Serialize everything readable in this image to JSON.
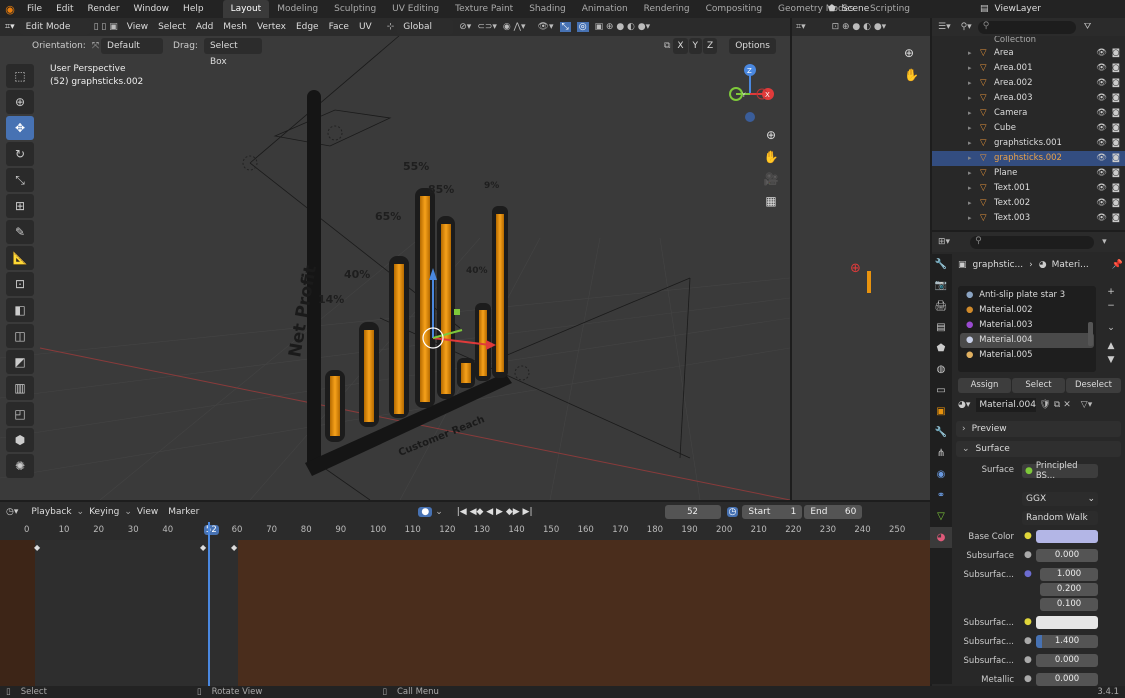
{
  "topbar": {
    "menus": [
      "File",
      "Edit",
      "Render",
      "Window",
      "Help"
    ],
    "workspaces": [
      "Layout",
      "Modeling",
      "Sculpting",
      "UV Editing",
      "Texture Paint",
      "Shading",
      "Animation",
      "Rendering",
      "Compositing",
      "Geometry Nodes",
      "Scripting"
    ],
    "scene": "Scene",
    "view_layer": "ViewLayer"
  },
  "viewport_header": {
    "mode": "Edit Mode",
    "menus": [
      "View",
      "Select",
      "Add",
      "Mesh",
      "Vertex",
      "Edge",
      "Face",
      "UV"
    ],
    "transform": "Global",
    "orientation_label": "Orientation:",
    "orientation_value": "Default",
    "drag_label": "Drag:",
    "drag_value": "Select Box",
    "axes": [
      "X",
      "Y",
      "Z"
    ],
    "options": "Options"
  },
  "viewport_info": {
    "perspective": "User Perspective",
    "object": "(52) graphsticks.002"
  },
  "chart3d_labels": {
    "ylabel": "Net Profit",
    "xlabel": "Customer Reach",
    "pcts": [
      "55%",
      "65%",
      "40%",
      "85%",
      "9%",
      "40%",
      "14%"
    ]
  },
  "gizmo": {
    "z": "Z",
    "y": "Y",
    "x": "X"
  },
  "outliner": {
    "collection": "Collection",
    "items": [
      {
        "name": "Area",
        "selected": false
      },
      {
        "name": "Area.001",
        "selected": false
      },
      {
        "name": "Area.002",
        "selected": false
      },
      {
        "name": "Area.003",
        "selected": false
      },
      {
        "name": "Camera",
        "selected": false
      },
      {
        "name": "Cube",
        "selected": false
      },
      {
        "name": "graphsticks.001",
        "selected": false
      },
      {
        "name": "graphsticks.002",
        "selected": true
      },
      {
        "name": "Plane",
        "selected": false
      },
      {
        "name": "Text.001",
        "selected": false
      },
      {
        "name": "Text.002",
        "selected": false
      },
      {
        "name": "Text.003",
        "selected": false
      }
    ]
  },
  "properties": {
    "breadcrumb_obj": "graphstic...",
    "breadcrumb_mat": "Materi...",
    "materials": [
      "Anti-slip plate star 3",
      "Material.002",
      "Material.003",
      "Material.004",
      "Material.005"
    ],
    "selected_material": "Material.004",
    "assign": "Assign",
    "select": "Select",
    "deselect": "Deselect",
    "material_name": "Material.004",
    "preview": "Preview",
    "surface_section": "Surface",
    "surface_label": "Surface",
    "surface_value": "Principled BS...",
    "distribution": "GGX",
    "sss_method": "Random Walk",
    "base_color_label": "Base Color",
    "base_color": "#b3b6e6",
    "subsurface_label": "Subsurface",
    "subsurface_value": "0.000",
    "subsurface_radius_label": "Subsurfac...",
    "radius": [
      "1.000",
      "0.200",
      "0.100"
    ],
    "subsurface_color_label": "Subsurfac...",
    "subsurface_ior_label": "Subsurfac...",
    "subsurface_ior": "1.400",
    "subsurface_aniso_label": "Subsurfac...",
    "subsurface_aniso": "0.000",
    "metallic_label": "Metallic",
    "metallic": "0.000"
  },
  "timeline": {
    "menus": [
      "Playback",
      "Keying",
      "View",
      "Marker"
    ],
    "current_frame": "52",
    "start_label": "Start",
    "start": "1",
    "end_label": "End",
    "end": "60",
    "ruler": [
      "0",
      "10",
      "20",
      "30",
      "40",
      "52",
      "60",
      "70",
      "80",
      "90",
      "100",
      "110",
      "120",
      "130",
      "140",
      "150",
      "160",
      "170",
      "180",
      "190",
      "200",
      "210",
      "220",
      "230",
      "240",
      "250"
    ]
  },
  "status": {
    "select": "Select",
    "rotate": "Rotate View",
    "call_menu": "Call Menu",
    "version": "3.4.1"
  },
  "colors": {
    "accent": "#4772b3",
    "bar": "#e8930e",
    "timeline_bg": "#4a2d1c"
  }
}
